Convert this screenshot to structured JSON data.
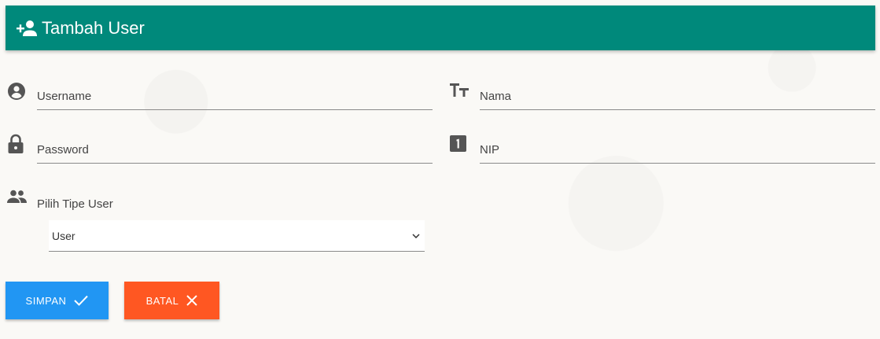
{
  "header": {
    "title": "Tambah User",
    "icon": "person-add-icon",
    "bg": "#00897b"
  },
  "form": {
    "username": {
      "placeholder": "Username",
      "icon": "account-circle-icon"
    },
    "nama": {
      "placeholder": "Nama",
      "icon": "text-fields-icon"
    },
    "password": {
      "placeholder": "Password",
      "icon": "lock-icon"
    },
    "nip": {
      "placeholder": "NIP",
      "icon": "looks-one-icon"
    },
    "tipe_user": {
      "label": "Pilih Tipe User",
      "selected": "User",
      "icon": "people-icon"
    }
  },
  "actions": {
    "save": {
      "label": "SIMPAN",
      "color": "#2196f3",
      "icon": "check-icon"
    },
    "cancel": {
      "label": "BATAL",
      "color": "#ff5722",
      "icon": "close-icon"
    }
  }
}
